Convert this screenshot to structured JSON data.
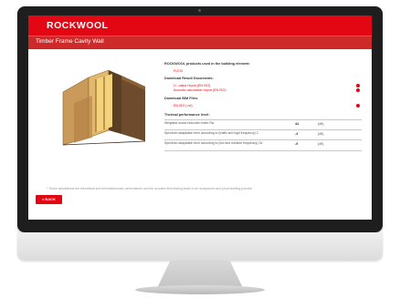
{
  "app": {
    "logo": "ROCKWOOL",
    "page_title": "Timber Frame Cavity Wall"
  },
  "details": {
    "products_heading": "ROCKWOOL products used in the building element:",
    "product": "FLEXI",
    "downloads_heading": "Download Result Documents:",
    "documents": [
      "U - value report (EN ISO)",
      "Acoustic calculation report (EN ISO)"
    ],
    "bim_heading": "Download BIM Files:",
    "bim_file": "EN ISO (.rvt)",
    "perf_heading": "Thermal performance level:",
    "performance": [
      {
        "label": "Weighted sound reduction index Rw",
        "value": "44",
        "unit": "[dB]"
      },
      {
        "label": "Spectrum adaptation term according to (traffic and high frequency) C",
        "value": "-4",
        "unit": "[dB]"
      },
      {
        "label": "Spectrum adaptation term according to (low and medium frequency) Ctr",
        "value": "-9",
        "unit": "[dB]"
      }
    ]
  },
  "footnote": "* These calculations are theoretical and thermal/acoustic performance and the acoustic field testing leads to an acceptance and proof building practice",
  "buttons": {
    "back": "< BACK"
  },
  "colors": {
    "brand_red": "#e30613",
    "title_bar": "#cf2a2a",
    "bezel": "#1e1e1e"
  }
}
